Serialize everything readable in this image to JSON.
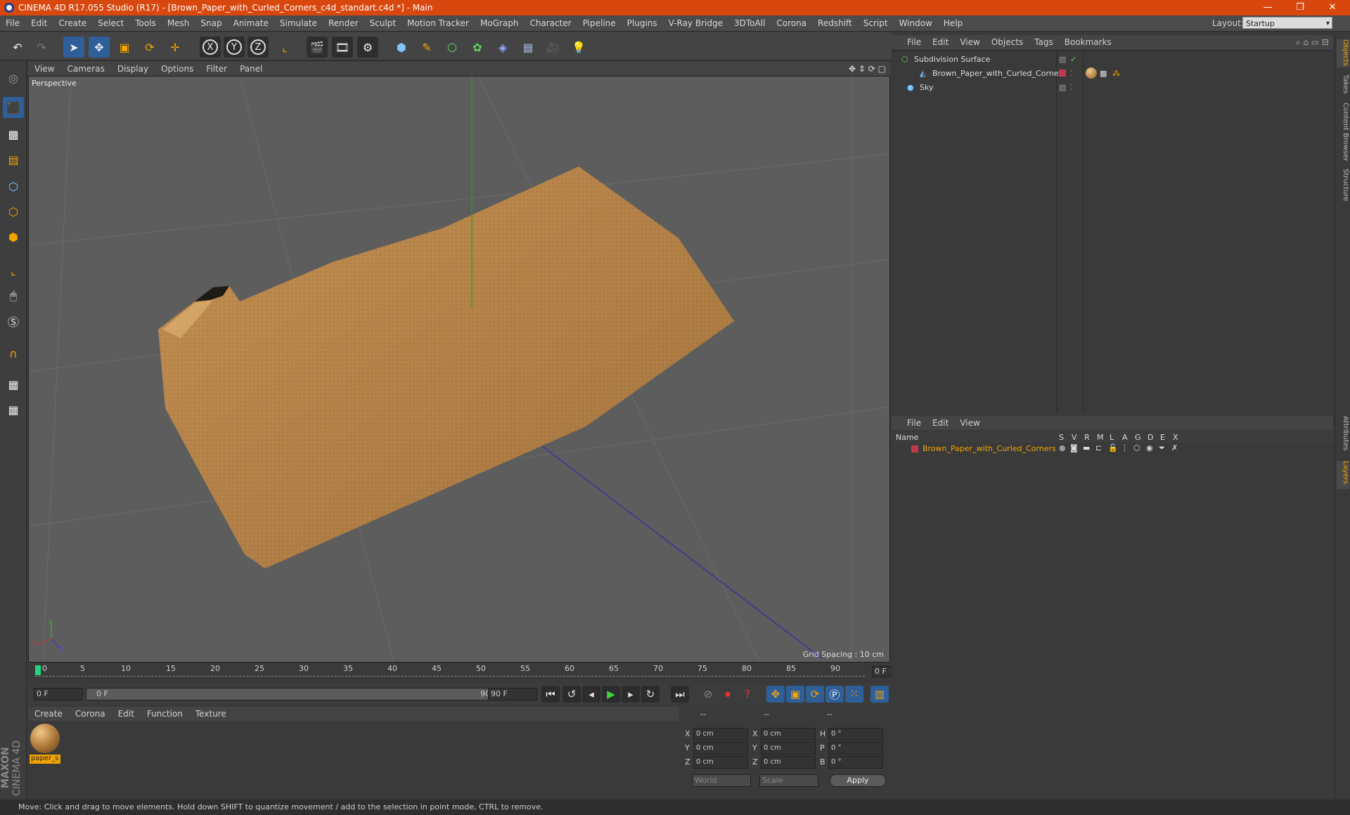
{
  "window": {
    "title": "CINEMA 4D R17.055 Studio (R17) - [Brown_Paper_with_Curled_Corners_c4d_standart.c4d *] - Main",
    "minimize": "—",
    "restore": "❐",
    "close": "✕"
  },
  "menubar": {
    "items": [
      "File",
      "Edit",
      "Create",
      "Select",
      "Tools",
      "Mesh",
      "Snap",
      "Animate",
      "Simulate",
      "Render",
      "Sculpt",
      "Motion Tracker",
      "MoGraph",
      "Character",
      "Pipeline",
      "Plugins",
      "V-Ray Bridge",
      "3DToAll",
      "Corona",
      "Redshift",
      "Script",
      "Window",
      "Help"
    ],
    "layout_label": "Layout:",
    "layout_value": "Startup"
  },
  "toolbar": {
    "x_label": "X",
    "y_label": "Y",
    "z_label": "Z"
  },
  "viewport": {
    "menu": [
      "View",
      "Cameras",
      "Display",
      "Options",
      "Filter",
      "Panel"
    ],
    "label": "Perspective",
    "grid_spacing": "Grid Spacing : 10 cm",
    "axis_y": "Y",
    "axis_x": "X",
    "axis_z": "Z"
  },
  "timeline": {
    "ticks": [
      "0",
      "5",
      "10",
      "15",
      "20",
      "25",
      "30",
      "35",
      "40",
      "45",
      "50",
      "55",
      "60",
      "65",
      "70",
      "75",
      "80",
      "85",
      "90"
    ],
    "current_frame": "0 F"
  },
  "transport": {
    "start_field": "0 F",
    "range_start": "0 F",
    "range_end": "90 F",
    "end_field": "90 F"
  },
  "material_manager": {
    "menu": [
      "Create",
      "Corona",
      "Edit",
      "Function",
      "Texture"
    ],
    "material_name": "paper_s"
  },
  "coordinates": {
    "header": [
      "--",
      "--",
      "--"
    ],
    "rows": [
      {
        "axis1": "X",
        "val1": "0 cm",
        "axis2": "X",
        "val2": "0 cm",
        "axis3": "H",
        "val3": "0 °"
      },
      {
        "axis1": "Y",
        "val1": "0 cm",
        "axis2": "Y",
        "val2": "0 cm",
        "axis3": "P",
        "val3": "0 °"
      },
      {
        "axis1": "Z",
        "val1": "0 cm",
        "axis2": "Z",
        "val2": "0 cm",
        "axis3": "B",
        "val3": "0 °"
      }
    ],
    "world_select": "World",
    "scale_select": "Scale",
    "apply_button": "Apply"
  },
  "object_manager": {
    "menu": [
      "File",
      "Edit",
      "View",
      "Objects",
      "Tags",
      "Bookmarks"
    ],
    "objects": [
      {
        "name": "Subdivision Surface"
      },
      {
        "name": "Brown_Paper_with_Curled_Corners"
      },
      {
        "name": "Sky"
      }
    ]
  },
  "layer_manager": {
    "menu": [
      "File",
      "Edit",
      "View"
    ],
    "columns": [
      "Name",
      "S",
      "V",
      "R",
      "M",
      "L",
      "A",
      "G",
      "D",
      "E",
      "X"
    ],
    "layers": [
      {
        "name": "Brown_Paper_with_Curled_Corners",
        "color": "#c0394f"
      }
    ]
  },
  "right_tabs": [
    "Objects",
    "Takes",
    "Content Browser",
    "Structure",
    "Attributes",
    "Layers"
  ],
  "logo": {
    "line1": "MAXON",
    "line2": "CINEMA 4D"
  },
  "status": "Move: Click and drag to move elements. Hold down SHIFT to quantize movement / add to the selection in point mode, CTRL to remove.",
  "colors": {
    "accent": "#d8480e",
    "selection": "#f2a300",
    "paper": "#b98448"
  }
}
